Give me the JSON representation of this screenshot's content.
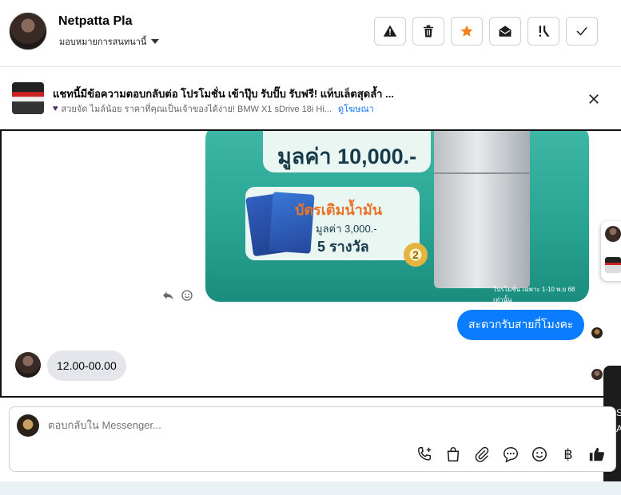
{
  "header": {
    "contact_name": "Netpatta Pla",
    "assign_label": "มอบหมายการสนทนานี้",
    "actions": [
      {
        "name": "report-button",
        "icon": "warning-icon"
      },
      {
        "name": "delete-button",
        "icon": "trash-icon"
      },
      {
        "name": "star-button",
        "icon": "star-icon"
      },
      {
        "name": "mark-unread-button",
        "icon": "envelope-open-icon"
      },
      {
        "name": "follow-up-button",
        "icon": "important-icon"
      },
      {
        "name": "done-button",
        "icon": "check-icon"
      }
    ],
    "star_color": "#f5821f"
  },
  "promo": {
    "title": "แชทนี้มีข้อความตอบกลับต่อ โปรโมชั่น เข้าปุ๊บ รับปั๊บ รับฟรี! แท็บเล็ตสุดล้ำ ...",
    "subtitle": "สวยจัด ไมล์น้อย ราคาที่คุณเป็นเจ้าของได้ง่าย! BMW X1 sDrive 18i Hi...",
    "link_label": "ดูโฆษณา"
  },
  "messages": {
    "image_texts": {
      "top": "มูลค่า 10,000.-",
      "card_title": "บัตรเติมน้ำมัน",
      "card_value": "มูลค่า 3,000.-",
      "card_count": "5 รางวัล",
      "fine_print": "โปรโมชั่น เฉพาะ 1-10 พ.ย 68 เท่านั้น",
      "medal": "2"
    },
    "outgoing": "สะดวกรับสายกี่โมงคะ",
    "incoming": "12.00-00.00"
  },
  "side_panel": {
    "letter_s": "S",
    "letter_a": "A"
  },
  "composer": {
    "placeholder": "ตอบกลับใน Messenger...",
    "currency_symbol": "฿"
  },
  "colors": {
    "accent": "#0a7cff",
    "link": "#1877f2"
  }
}
